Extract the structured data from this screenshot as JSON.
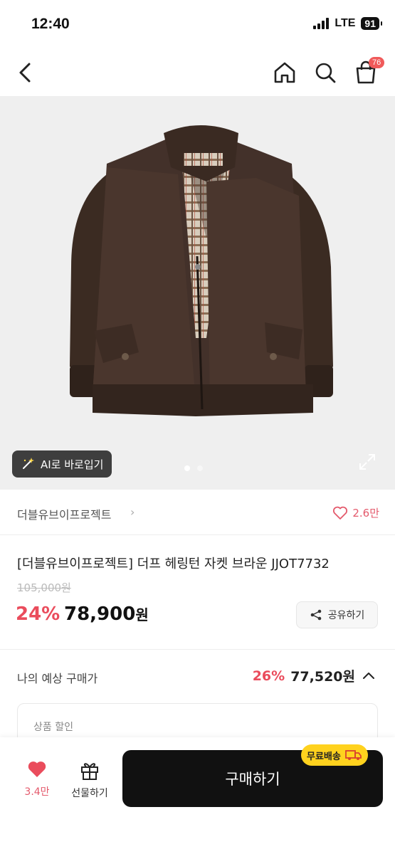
{
  "status": {
    "time": "12:40",
    "network": "LTE",
    "battery": "91"
  },
  "nav": {
    "cart_count": "76"
  },
  "gallery": {
    "ai_button_label": "AI로 바로입기",
    "slides": 2,
    "active_slide": 1
  },
  "brand": {
    "name": "더블유브이프로젝트",
    "likes": "2.6만"
  },
  "product": {
    "title": "[더블유브이프로젝트] 더프 헤링턴 자켓 브라운 JJOT7732",
    "original_price": "105,000원",
    "discount_rate": "24%",
    "sale_price": "78,900",
    "sale_price_unit": "원",
    "share_label": "공유하기"
  },
  "estimate": {
    "label": "나의 예상 구매가",
    "discount_rate": "26%",
    "price": "77,520원"
  },
  "discount_box": {
    "label": "상품 할인"
  },
  "bottom": {
    "wish_count": "3.4만",
    "gift_label": "선물하기",
    "buy_label": "구매하기",
    "free_shipping_label": "무료배송"
  },
  "colors": {
    "accent": "#ea4c5c",
    "buy_button": "#111111",
    "free_ship": "#ffd21e"
  }
}
